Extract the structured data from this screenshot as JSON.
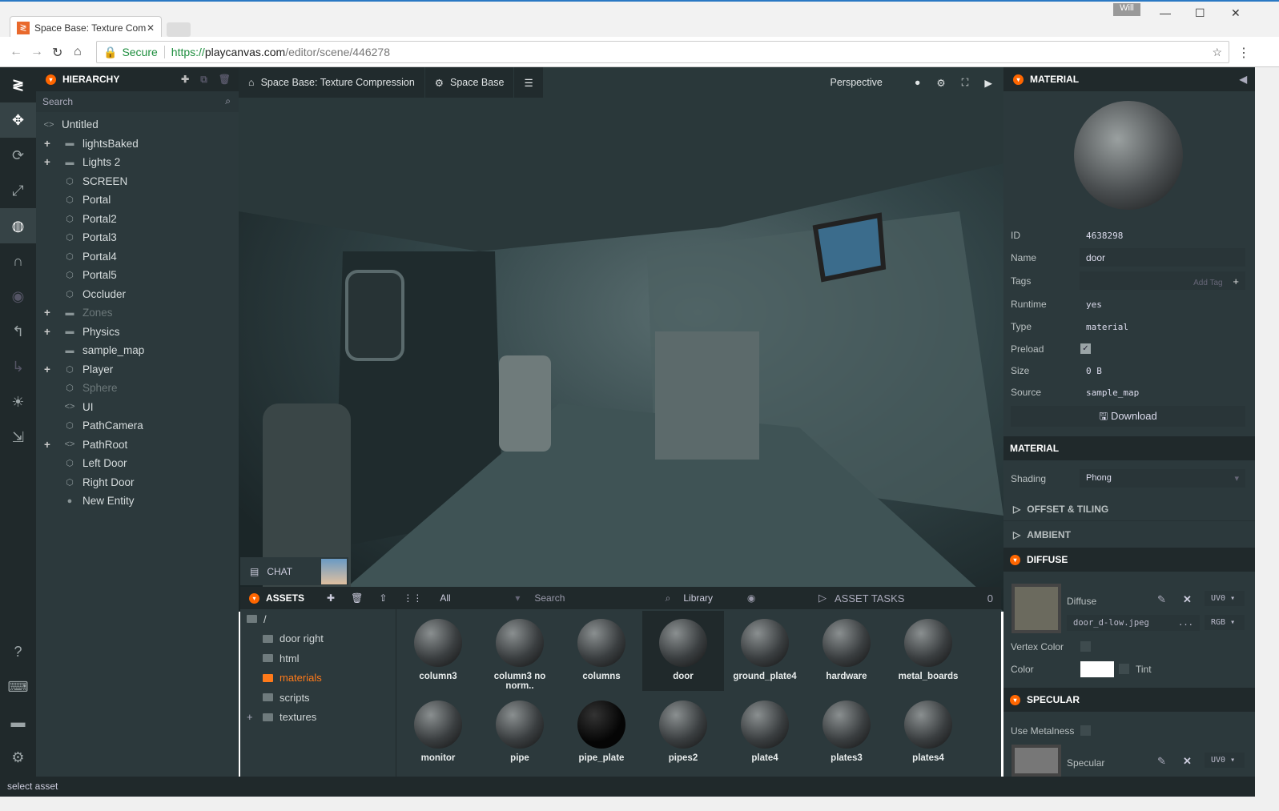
{
  "browser": {
    "tab_title": "Space Base: Texture Com",
    "user": "Will",
    "secure_label": "Secure",
    "url_scheme": "https://",
    "url_host": "playcanvas.com",
    "url_path": "/editor/scene/446278"
  },
  "hierarchy": {
    "title": "HIERARCHY",
    "search_placeholder": "Search",
    "items": [
      {
        "label": "Untitled",
        "icon": "code",
        "expand": false,
        "dim": false,
        "indent": 0
      },
      {
        "label": "lightsBaked",
        "icon": "folder",
        "expand": true,
        "dim": false,
        "indent": 1
      },
      {
        "label": "Lights 2",
        "icon": "folder",
        "expand": true,
        "dim": false,
        "indent": 1
      },
      {
        "label": "SCREEN",
        "icon": "cube",
        "expand": false,
        "dim": false,
        "indent": 1
      },
      {
        "label": "Portal",
        "icon": "cube",
        "expand": false,
        "dim": false,
        "indent": 1
      },
      {
        "label": "Portal2",
        "icon": "cube",
        "expand": false,
        "dim": false,
        "indent": 1
      },
      {
        "label": "Portal3",
        "icon": "cube",
        "expand": false,
        "dim": false,
        "indent": 1
      },
      {
        "label": "Portal4",
        "icon": "cube",
        "expand": false,
        "dim": false,
        "indent": 1
      },
      {
        "label": "Portal5",
        "icon": "cube",
        "expand": false,
        "dim": false,
        "indent": 1
      },
      {
        "label": "Occluder",
        "icon": "cube",
        "expand": false,
        "dim": false,
        "indent": 1
      },
      {
        "label": "Zones",
        "icon": "folder",
        "expand": true,
        "dim": true,
        "indent": 1
      },
      {
        "label": "Physics",
        "icon": "folder",
        "expand": true,
        "dim": false,
        "indent": 1
      },
      {
        "label": "sample_map",
        "icon": "folder",
        "expand": false,
        "dim": false,
        "indent": 1
      },
      {
        "label": "Player",
        "icon": "entity",
        "expand": true,
        "dim": false,
        "indent": 1
      },
      {
        "label": "Sphere",
        "icon": "cube",
        "expand": false,
        "dim": true,
        "indent": 1
      },
      {
        "label": "UI",
        "icon": "code",
        "expand": false,
        "dim": false,
        "indent": 1
      },
      {
        "label": "PathCamera",
        "icon": "cube",
        "expand": false,
        "dim": false,
        "indent": 1
      },
      {
        "label": "PathRoot",
        "icon": "code",
        "expand": true,
        "dim": false,
        "indent": 1
      },
      {
        "label": "Left Door",
        "icon": "cube",
        "expand": false,
        "dim": false,
        "indent": 1
      },
      {
        "label": "Right Door",
        "icon": "cube",
        "expand": false,
        "dim": false,
        "indent": 1
      },
      {
        "label": "New Entity",
        "icon": "sphere",
        "expand": false,
        "dim": false,
        "indent": 1
      }
    ]
  },
  "viewport": {
    "project": "Space Base: Texture Compression",
    "scene": "Space Base",
    "camera": "Perspective"
  },
  "chat": {
    "label": "CHAT"
  },
  "assets": {
    "title": "ASSETS",
    "filter": "All",
    "search_placeholder": "Search",
    "library": "Library",
    "tasks_title": "ASSET TASKS",
    "tasks_count": "0",
    "folders": [
      {
        "label": "/",
        "active": false
      },
      {
        "label": "door right",
        "active": false
      },
      {
        "label": "html",
        "active": false
      },
      {
        "label": "materials",
        "active": true
      },
      {
        "label": "scripts",
        "active": false
      },
      {
        "label": "textures",
        "active": false
      }
    ],
    "items": [
      {
        "label": "column3",
        "selected": false
      },
      {
        "label": "column3 no norm..",
        "selected": false
      },
      {
        "label": "columns",
        "selected": false
      },
      {
        "label": "door",
        "selected": true
      },
      {
        "label": "ground_plate4",
        "selected": false
      },
      {
        "label": "hardware",
        "selected": false
      },
      {
        "label": "metal_boards",
        "selected": false
      },
      {
        "label": "monitor",
        "selected": false
      },
      {
        "label": "pipe",
        "selected": false
      },
      {
        "label": "pipe_plate",
        "selected": false
      },
      {
        "label": "pipes2",
        "selected": false
      },
      {
        "label": "plate4",
        "selected": false
      },
      {
        "label": "plates3",
        "selected": false
      },
      {
        "label": "plates4",
        "selected": false
      }
    ]
  },
  "inspector": {
    "title": "MATERIAL",
    "id_label": "ID",
    "id": "4638298",
    "name_label": "Name",
    "name": "door",
    "tags_label": "Tags",
    "add_tag": "Add Tag",
    "runtime_label": "Runtime",
    "runtime": "yes",
    "type_label": "Type",
    "type": "material",
    "preload_label": "Preload",
    "preload": true,
    "size_label": "Size",
    "size": "0 B",
    "source_label": "Source",
    "source": "sample_map",
    "download": "Download",
    "material_header": "MATERIAL",
    "shading_label": "Shading",
    "shading": "Phong",
    "offset_tiling": "OFFSET & TILING",
    "ambient": "AMBIENT",
    "diffuse_header": "DIFFUSE",
    "diffuse_label": "Diffuse",
    "diffuse_uv": "UV0",
    "diffuse_file": "door_d-low.jpeg",
    "diffuse_more": "...",
    "diffuse_channel": "RGB",
    "vertex_color_label": "Vertex Color",
    "color_label": "Color",
    "tint_label": "Tint",
    "specular_header": "SPECULAR",
    "use_metalness_label": "Use Metalness",
    "specular_label": "Specular",
    "specular_uv": "UV0"
  },
  "status": {
    "text": "select asset"
  },
  "colors": {
    "accent": "#ff6600",
    "panel": "#2c393c",
    "dark": "#20292b"
  }
}
